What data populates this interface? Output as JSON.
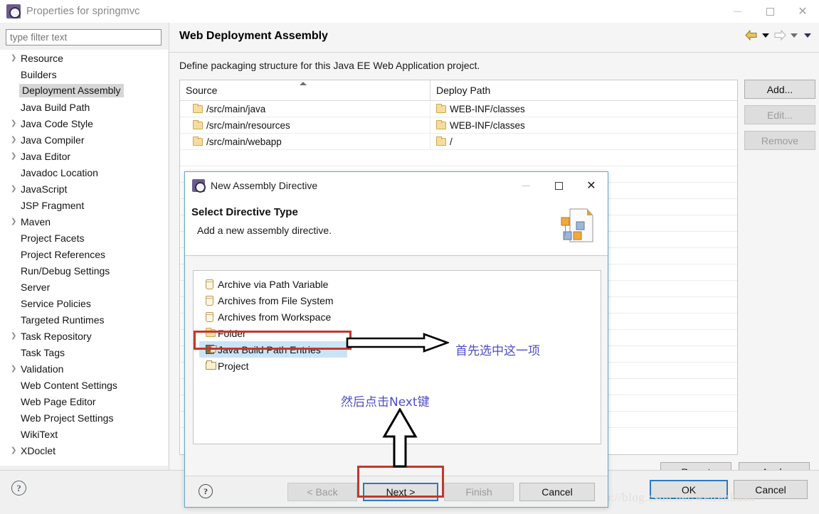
{
  "window": {
    "title": "Properties for springmvc",
    "icon": "eclipse-icon",
    "controls": {
      "minimize": "minimize-icon",
      "maximize": "maximize-icon",
      "close": "close-icon"
    }
  },
  "sidebar": {
    "filter": {
      "placeholder": "type filter text",
      "value": ""
    },
    "items": [
      {
        "label": "Resource",
        "expandable": true,
        "selected": false
      },
      {
        "label": "Builders",
        "expandable": false,
        "selected": false
      },
      {
        "label": "Deployment Assembly",
        "expandable": false,
        "selected": true
      },
      {
        "label": "Java Build Path",
        "expandable": false,
        "selected": false
      },
      {
        "label": "Java Code Style",
        "expandable": true,
        "selected": false
      },
      {
        "label": "Java Compiler",
        "expandable": true,
        "selected": false
      },
      {
        "label": "Java Editor",
        "expandable": true,
        "selected": false
      },
      {
        "label": "Javadoc Location",
        "expandable": false,
        "selected": false
      },
      {
        "label": "JavaScript",
        "expandable": true,
        "selected": false
      },
      {
        "label": "JSP Fragment",
        "expandable": false,
        "selected": false
      },
      {
        "label": "Maven",
        "expandable": true,
        "selected": false
      },
      {
        "label": "Project Facets",
        "expandable": false,
        "selected": false
      },
      {
        "label": "Project References",
        "expandable": false,
        "selected": false
      },
      {
        "label": "Run/Debug Settings",
        "expandable": false,
        "selected": false
      },
      {
        "label": "Server",
        "expandable": false,
        "selected": false
      },
      {
        "label": "Service Policies",
        "expandable": false,
        "selected": false
      },
      {
        "label": "Targeted Runtimes",
        "expandable": false,
        "selected": false
      },
      {
        "label": "Task Repository",
        "expandable": true,
        "selected": false
      },
      {
        "label": "Task Tags",
        "expandable": false,
        "selected": false
      },
      {
        "label": "Validation",
        "expandable": true,
        "selected": false
      },
      {
        "label": "Web Content Settings",
        "expandable": false,
        "selected": false
      },
      {
        "label": "Web Page Editor",
        "expandable": false,
        "selected": false
      },
      {
        "label": "Web Project Settings",
        "expandable": false,
        "selected": false
      },
      {
        "label": "WikiText",
        "expandable": false,
        "selected": false
      },
      {
        "label": "XDoclet",
        "expandable": true,
        "selected": false
      }
    ],
    "help_icon": "help-icon"
  },
  "panel": {
    "title": "Web Deployment Assembly",
    "description": "Define packaging structure for this Java EE Web Application project.",
    "nav": {
      "back_icon": "back-arrow-icon",
      "back_menu_icon": "chevron-down-icon",
      "forward_icon": "forward-arrow-icon",
      "forward_menu_icon": "chevron-down-icon",
      "view_menu_icon": "chevron-down-icon"
    },
    "table": {
      "columns": [
        "Source",
        "Deploy Path"
      ],
      "sort_column": "Source",
      "sort_direction": "ascending",
      "rows": [
        {
          "source": "/src/main/java",
          "deploy": "WEB-INF/classes"
        },
        {
          "source": "/src/main/resources",
          "deploy": "WEB-INF/classes"
        },
        {
          "source": "/src/main/webapp",
          "deploy": "/"
        }
      ]
    },
    "buttons": {
      "add": "Add...",
      "edit": "Edit...",
      "remove": "Remove",
      "revert": "Revert",
      "apply": "Apply"
    }
  },
  "footer": {
    "ok": "OK",
    "cancel": "Cancel",
    "watermark": "http://blog.csdn.net/weirenkuan"
  },
  "dialog": {
    "title": "New Assembly Directive",
    "icon": "eclipse-icon",
    "heading": "Select Directive Type",
    "subtext": "Add a new assembly directive.",
    "banner_icon": "assembly-directive-icon",
    "controls": {
      "minimize": "minimize-icon",
      "maximize": "maximize-icon",
      "close": "close-icon"
    },
    "list": [
      {
        "label": "Archive via Path Variable",
        "icon": "jar-icon",
        "selected": false
      },
      {
        "label": "Archives from File System",
        "icon": "jar-icon",
        "selected": false
      },
      {
        "label": "Archives from Workspace",
        "icon": "jar-icon",
        "selected": false
      },
      {
        "label": "Folder",
        "icon": "folder-icon",
        "selected": false
      },
      {
        "label": "Java Build Path Entries",
        "icon": "books-icon",
        "selected": true
      },
      {
        "label": "Project",
        "icon": "open-folder-icon",
        "selected": false
      }
    ],
    "buttons": {
      "back": "< Back",
      "next": "Next >",
      "finish": "Finish",
      "cancel": "Cancel"
    },
    "help_icon": "help-icon"
  },
  "annotations": {
    "select_item": "首先选中这一项",
    "click_next": "然后点击Next键",
    "arrow_to_item": "arrow-right-icon",
    "arrow_to_next": "arrow-up-icon",
    "highlight_color": "#c0392b",
    "text_color": "#4e4ec8"
  }
}
